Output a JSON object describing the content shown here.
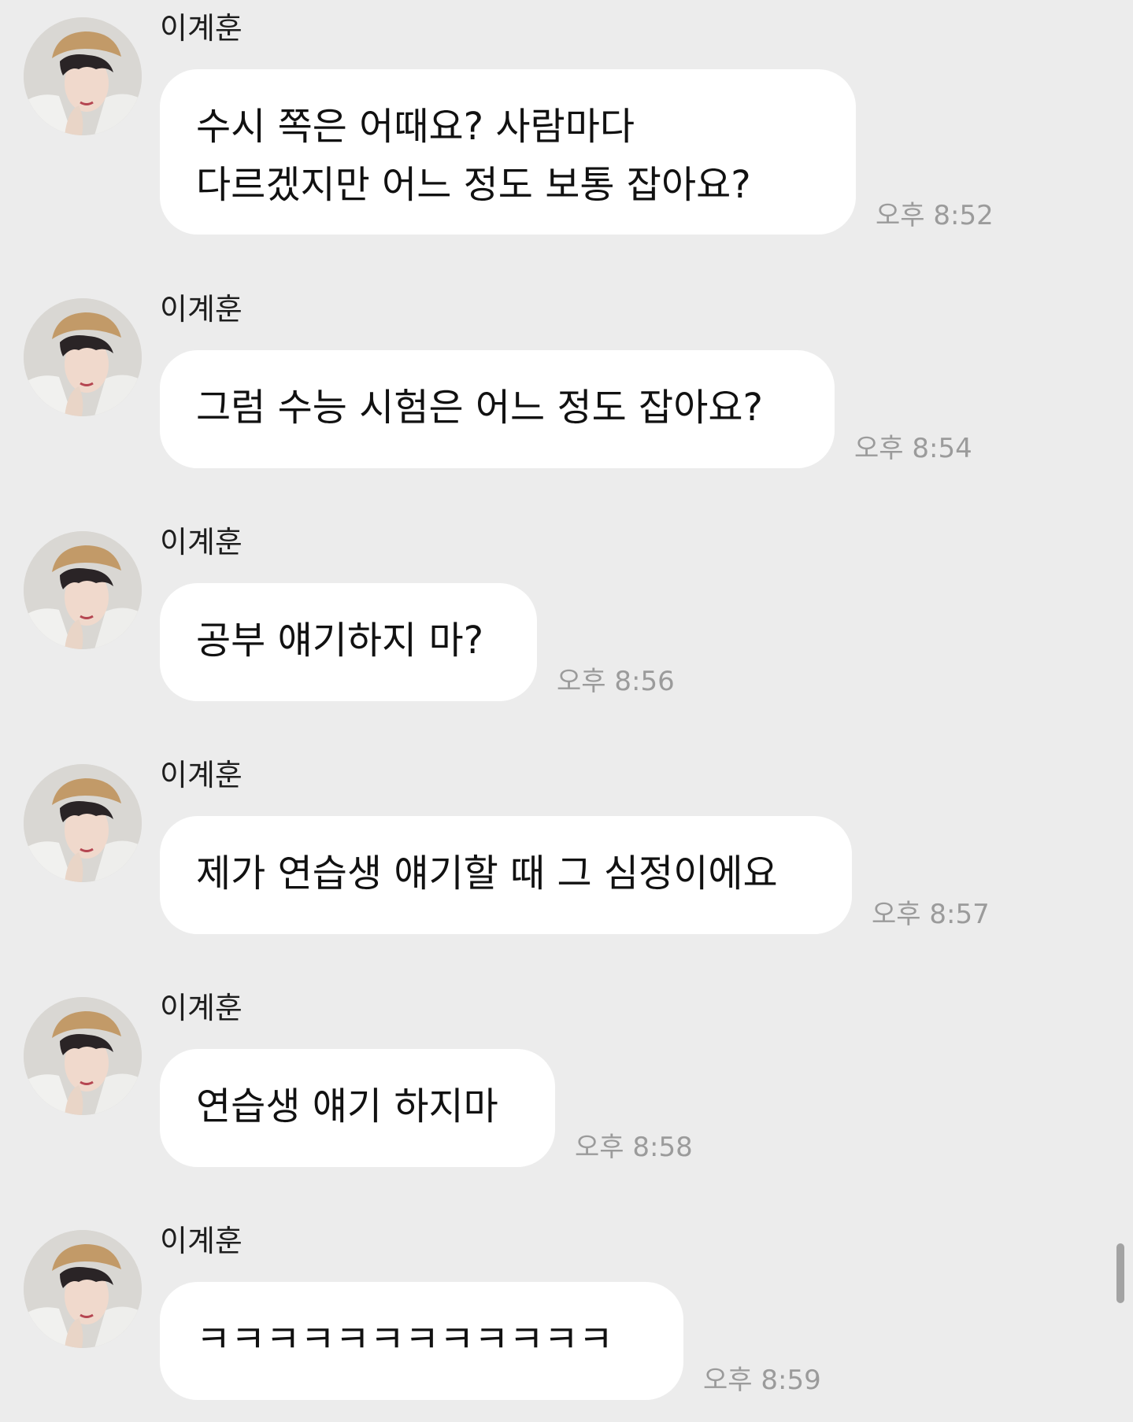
{
  "colors": {
    "background": "#ececec",
    "bubble": "#ffffff",
    "text": "#111111",
    "timestamp": "#9b9b9b"
  },
  "messages": [
    {
      "sender": "이계훈",
      "lines": [
        "수시 쪽은 어때요? 사람마다",
        "다르겠지만 어느 정도 보통 잡아요?"
      ],
      "time": "오후 8:52",
      "avatar_icon": "profile-photo"
    },
    {
      "sender": "이계훈",
      "lines": [
        "그럼 수능 시험은 어느 정도 잡아요?"
      ],
      "time": "오후 8:54",
      "avatar_icon": "profile-photo"
    },
    {
      "sender": "이계훈",
      "lines": [
        "공부 얘기하지 마?"
      ],
      "time": "오후 8:56",
      "avatar_icon": "profile-photo"
    },
    {
      "sender": "이계훈",
      "lines": [
        "제가 연습생 얘기할 때 그 심정이에요"
      ],
      "time": "오후 8:57",
      "avatar_icon": "profile-photo"
    },
    {
      "sender": "이계훈",
      "lines": [
        "연습생 얘기 하지마"
      ],
      "time": "오후 8:58",
      "avatar_icon": "profile-photo"
    },
    {
      "sender": "이계훈",
      "lines": [
        "ㅋㅋㅋㅋㅋㅋㅋㅋㅋㅋㅋㅋ"
      ],
      "time": "오후 8:59",
      "avatar_icon": "profile-photo"
    }
  ]
}
